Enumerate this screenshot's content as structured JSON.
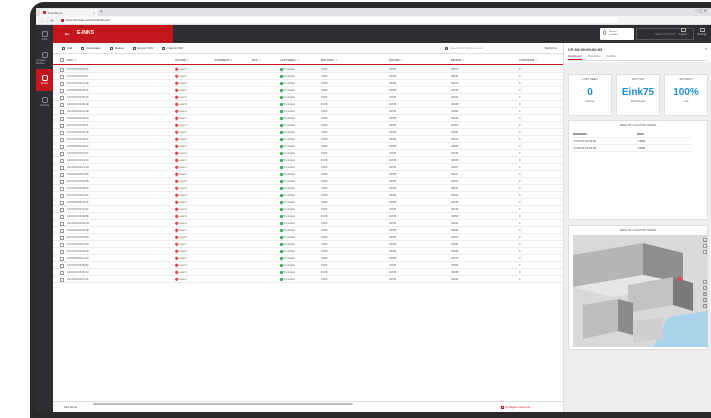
{
  "browser": {
    "tab_title": "Live Room",
    "tab_close": "×",
    "new_tab": "+",
    "window_controls": "─ ▢ ✕",
    "nav_buttons": "← → ⟳",
    "url": "https://kontakt.io/kiosk/dashboard"
  },
  "sidenav": {
    "items": [
      {
        "label": "Apps",
        "icon": "apps-icon"
      },
      {
        "label": "Location Devices",
        "icon": "location-devices-icon"
      },
      {
        "label": "E-inks",
        "icon": "e-inks-icon"
      },
      {
        "label": "Tracking",
        "icon": "tracking-icon"
      }
    ]
  },
  "header": {
    "logo_text": "E-INKS",
    "logo_mark": "kio",
    "minions_count": "0",
    "minions_label_1": "Minions",
    "minions_label_2": "available",
    "device_select_placeholder": "SELECT DEVICE",
    "btn_layout": "Layout",
    "btn_settings": "Settings"
  },
  "toolbar": {
    "add": "Add",
    "investigate": "Investigate",
    "delete": "Delete",
    "export_csv": "Export CSV",
    "import_csv": "Import CSV",
    "search_placeholder": "Search for Name of item",
    "search_btn": "SEARCH"
  },
  "table": {
    "columns": [
      "MAC",
      "COORD",
      "COMMENT",
      "NFC",
      "LASTSEEN",
      "BATTERY",
      "MAJOR",
      "MINOR",
      "TXPOWER"
    ],
    "rows": [
      {
        "mac": "CF:03:00:00:00:36",
        "coord": "Level 1",
        "lastseen": "5 minutes",
        "battery": "100%",
        "major": "32765",
        "minor": "30371",
        "tx": "0"
      },
      {
        "mac": "CF:03:00:00:00:37",
        "coord": "Level 2",
        "lastseen": "5 minutes",
        "battery": "100%",
        "major": "32765",
        "minor": "30335",
        "tx": "0"
      },
      {
        "mac": "CF:03:00:00:01:1E",
        "coord": "Level 2",
        "lastseen": "5 minutes",
        "battery": "100%",
        "major": "32765",
        "minor": "30379",
        "tx": "0"
      },
      {
        "mac": "CF:03:00:00:00:3F",
        "coord": "Level 2",
        "lastseen": "5 minutes",
        "battery": "100%",
        "major": "32765",
        "minor": "30315",
        "tx": "0"
      },
      {
        "mac": "CF:03:00:00:00:3C",
        "coord": "Level 3",
        "lastseen": "5 minutes",
        "battery": "100%",
        "major": "32765",
        "minor": "30324",
        "tx": "0"
      },
      {
        "mac": "CF:03:00:00:00:4D",
        "coord": "Level 3",
        "lastseen": "5 minutes",
        "battery": "100%",
        "major": "32765",
        "minor": "30348",
        "tx": "0"
      },
      {
        "mac": "CF:03:00:00:01:1B",
        "coord": "Level 4",
        "lastseen": "5 minutes",
        "battery": "100%",
        "major": "32765",
        "minor": "30369",
        "tx": "0"
      },
      {
        "mac": "CF:03:00:00:00:4A",
        "coord": "Level 1",
        "lastseen": "5 minutes",
        "battery": "100%",
        "major": "32765",
        "minor": "30313",
        "tx": "0"
      },
      {
        "mac": "CF:03:00:00:00:71",
        "coord": "Level 1",
        "lastseen": "5 minutes",
        "battery": "100%",
        "major": "32765",
        "minor": "30381",
        "tx": "0"
      },
      {
        "mac": "CF:03:00:00:00:78",
        "coord": "Level 2",
        "lastseen": "5 minutes",
        "battery": "100%",
        "major": "32765",
        "minor": "30355",
        "tx": "0"
      },
      {
        "mac": "CF:03:00:00:00:42",
        "coord": "Level 2",
        "lastseen": "5 minutes",
        "battery": "100%",
        "major": "32765",
        "minor": "30313",
        "tx": "0"
      },
      {
        "mac": "CF:03:00:00:00:44",
        "coord": "Level 3",
        "lastseen": "5 minutes",
        "battery": "100%",
        "major": "32765",
        "minor": "30326",
        "tx": "0"
      },
      {
        "mac": "CF:03:00:00:01:27",
        "coord": "Level 4",
        "lastseen": "5 minutes",
        "battery": "100%",
        "major": "32765",
        "minor": "30343",
        "tx": "0"
      },
      {
        "mac": "CF:03:00:00:01:24",
        "coord": "Level 1",
        "lastseen": "5 minutes",
        "battery": "100%",
        "major": "32765",
        "minor": "30345",
        "tx": "0"
      },
      {
        "mac": "CF:03:00:00:01:1D",
        "coord": "Level 1",
        "lastseen": "5 minutes",
        "battery": "100%",
        "major": "32765",
        "minor": "30307",
        "tx": "0"
      },
      {
        "mac": "CF:03:00:00:01:38",
        "coord": "Level 2",
        "lastseen": "5 minutes",
        "battery": "100%",
        "major": "32765",
        "minor": "30317",
        "tx": "0"
      },
      {
        "mac": "CF:03:00:00:00:9B",
        "coord": "Level 2",
        "lastseen": "5 minutes",
        "battery": "100%",
        "major": "32765",
        "minor": "30331",
        "tx": "0"
      },
      {
        "mac": "CF:03:00:00:00:66",
        "coord": "Level 3",
        "lastseen": "5 minutes",
        "battery": "100%",
        "major": "32765",
        "minor": "30332",
        "tx": "0"
      },
      {
        "mac": "CF:03:00:00:01:05",
        "coord": "Level 3",
        "lastseen": "5 minutes",
        "battery": "100%",
        "major": "32765",
        "minor": "30334",
        "tx": "0"
      },
      {
        "mac": "CF:03:00:00:01:16",
        "coord": "Level 3",
        "lastseen": "5 minutes",
        "battery": "100%",
        "major": "32765",
        "minor": "30349",
        "tx": "0"
      },
      {
        "mac": "CF:03:00:00:01:32",
        "coord": "Level 2",
        "lastseen": "5 minutes",
        "battery": "100%",
        "major": "32765",
        "minor": "30318",
        "tx": "0"
      },
      {
        "mac": "CF:03:00:00:00:8E",
        "coord": "Level 3",
        "lastseen": "5 minutes",
        "battery": "100%",
        "major": "32765",
        "minor": "30352",
        "tx": "0"
      },
      {
        "mac": "CF:03:00:00:00:D9",
        "coord": "Level 4",
        "lastseen": "5 minutes",
        "battery": "100%",
        "major": "32765",
        "minor": "30334",
        "tx": "0"
      },
      {
        "mac": "CF:03:00:00:00:4B",
        "coord": "Level 1",
        "lastseen": "5 minutes",
        "battery": "100%",
        "major": "32765",
        "minor": "30336",
        "tx": "0"
      },
      {
        "mac": "CF:03:00:00:01:B2",
        "coord": "Level 2",
        "lastseen": "5 minutes",
        "battery": "100%",
        "major": "32765",
        "minor": "30304",
        "tx": "0"
      },
      {
        "mac": "CF:03:00:00:01:3D",
        "coord": "Level 1",
        "lastseen": "5 minutes",
        "battery": "100%",
        "major": "32765",
        "minor": "30395",
        "tx": "0"
      },
      {
        "mac": "CF:03:00:00:00:4D",
        "coord": "Level 2",
        "lastseen": "5 minutes",
        "battery": "100%",
        "major": "32765",
        "minor": "30349",
        "tx": "0"
      },
      {
        "mac": "CF:03:00:00:01:4C",
        "coord": "Level 2",
        "lastseen": "5 minutes",
        "battery": "100%",
        "major": "32765",
        "minor": "30375",
        "tx": "0"
      },
      {
        "mac": "CF:03:00:00:00:93",
        "coord": "Level 3",
        "lastseen": "5 minutes",
        "battery": "100%",
        "major": "32765",
        "minor": "30350",
        "tx": "0"
      },
      {
        "mac": "CF:03:00:00:00:A2",
        "coord": "Level 1",
        "lastseen": "5 minutes",
        "battery": "100%",
        "major": "32765",
        "minor": "30338",
        "tx": "0"
      },
      {
        "mac": "CF:03:00:00:01:45",
        "coord": "Level 2",
        "lastseen": "5 minutes",
        "battery": "100%",
        "major": "32765",
        "minor": "30330",
        "tx": "0"
      }
    ]
  },
  "footer": {
    "items_count": "102 items",
    "configure": "Configure columns"
  },
  "panel": {
    "title": "CF:03:00:00:00:03",
    "close": "×",
    "tabs": [
      "Dashboard",
      "Properties",
      "Additive"
    ],
    "cards": {
      "last_seen": {
        "title": "LAST SEEN",
        "value": "0",
        "unit": "minutes"
      },
      "hw_type": {
        "title": "HWTYPE",
        "value": "Eink75",
        "unit": "Blackboard"
      },
      "battery": {
        "title": "BATTERY",
        "value": "100%",
        "unit": "now"
      }
    },
    "locator_table": {
      "title": "SEEN BY LOCATOR NODES",
      "headers": [
        "NODEMAC",
        "RSSI"
      ],
      "rows": [
        {
          "mac": "C4:03:00:14:02:00",
          "rssi": "-73DB"
        },
        {
          "mac": "C4:03:00:14:00:09",
          "rssi": "-70DB"
        }
      ]
    },
    "map": {
      "title": "SEEN BY LOCATOR NODES"
    },
    "map_controls": [
      "+",
      "−",
      "•",
      "↕",
      "⤢",
      "✎",
      "⦿",
      "▭"
    ]
  }
}
